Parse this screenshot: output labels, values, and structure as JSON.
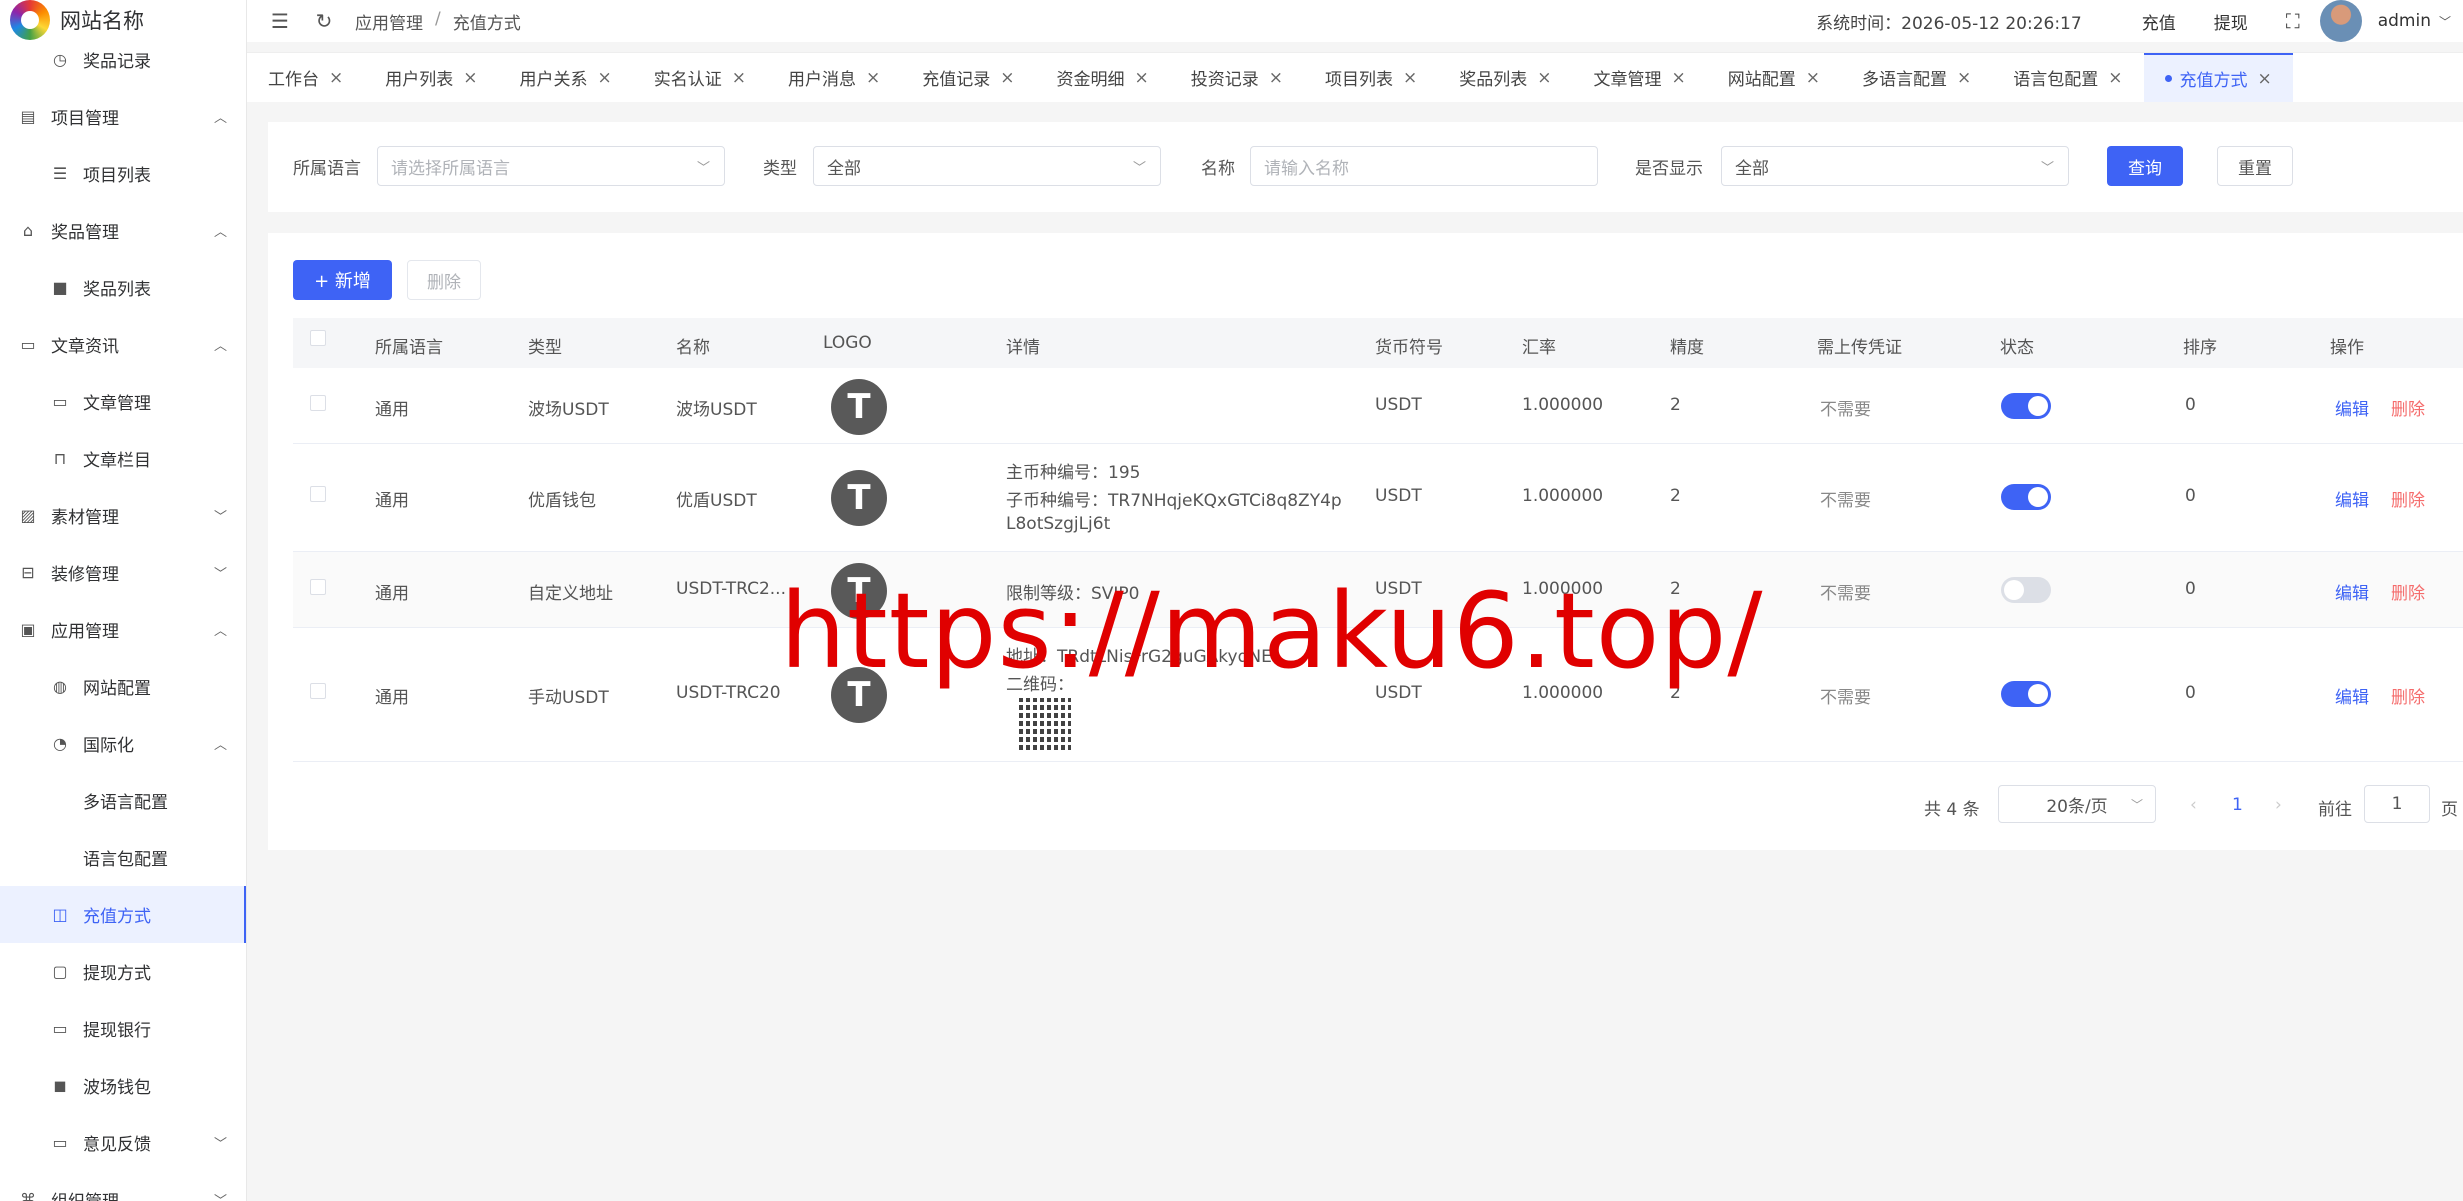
{
  "site": {
    "name": "网站名称"
  },
  "sidebar": {
    "items": [
      {
        "label": "奖品记录",
        "icon": "clock-icon"
      },
      {
        "label": "项目管理",
        "icon": "clipboard-icon",
        "expanded": true
      },
      {
        "label": "项目列表",
        "icon": "list-icon"
      },
      {
        "label": "奖品管理",
        "icon": "bag-icon",
        "expanded": true
      },
      {
        "label": "奖品列表",
        "icon": "bag-filled-icon"
      },
      {
        "label": "文章资讯",
        "icon": "message-icon",
        "expanded": true
      },
      {
        "label": "文章管理",
        "icon": "comment-icon"
      },
      {
        "label": "文章栏目",
        "icon": "bookmark-icon"
      },
      {
        "label": "素材管理",
        "icon": "picture-icon",
        "expanded": false
      },
      {
        "label": "装修管理",
        "icon": "brush-icon",
        "expanded": false
      },
      {
        "label": "应用管理",
        "icon": "app-icon",
        "expanded": true
      },
      {
        "label": "网站配置",
        "icon": "globe-icon"
      },
      {
        "label": "国际化",
        "icon": "compass-icon",
        "expanded": true
      },
      {
        "label": "多语言配置",
        "icon": ""
      },
      {
        "label": "语言包配置",
        "icon": ""
      },
      {
        "label": "充值方式",
        "icon": "wallet-icon",
        "active": true
      },
      {
        "label": "提现方式",
        "icon": "folder-icon"
      },
      {
        "label": "提现银行",
        "icon": "card-icon"
      },
      {
        "label": "波场钱包",
        "icon": "wallet-filled-icon"
      },
      {
        "label": "意见反馈",
        "icon": "feedback-icon",
        "expanded": false
      },
      {
        "label": "组织管理",
        "icon": "org-icon",
        "expanded": false
      }
    ]
  },
  "header": {
    "breadcrumb": [
      "应用管理",
      "充值方式"
    ],
    "breadcrumb_sep": "/",
    "system_time": "系统时间：2026-05-12 20:26:17",
    "recharge": "充值",
    "withdraw": "提现",
    "user": "admin"
  },
  "tabs": [
    "工作台",
    "用户列表",
    "用户关系",
    "实名认证",
    "用户消息",
    "充值记录",
    "资金明细",
    "投资记录",
    "项目列表",
    "奖品列表",
    "文章管理",
    "网站配置",
    "多语言配置",
    "语言包配置",
    "充值方式"
  ],
  "active_tab": "充值方式",
  "filter": {
    "lang_label": "所属语言",
    "lang_placeholder": "请选择所属语言",
    "type_label": "类型",
    "type_value": "全部",
    "name_label": "名称",
    "name_placeholder": "请输入名称",
    "show_label": "是否显示",
    "show_value": "全部",
    "query": "查询",
    "reset": "重置"
  },
  "toolbar": {
    "add": "+ 新增",
    "delete": "删除"
  },
  "table": {
    "columns": [
      "所属语言",
      "类型",
      "名称",
      "LOGO",
      "详情",
      "货币符号",
      "汇率",
      "精度",
      "需上传凭证",
      "状态",
      "排序",
      "操作"
    ],
    "edit": "编辑",
    "del": "删除",
    "rows": [
      {
        "lang": "通用",
        "type": "波场USDT",
        "name": "波场USDT",
        "details": [],
        "symbol": "USDT",
        "rate": "1.000000",
        "precision": "2",
        "proof": "不需要",
        "status": true,
        "sort": "0"
      },
      {
        "lang": "通用",
        "type": "优盾钱包",
        "name": "优盾USDT",
        "details": [
          "主币种编号：195",
          "子币种编号：TR7NHqjeKQxGTCi8q8ZY4p",
          "L8otSzgjLj6t"
        ],
        "symbol": "USDT",
        "rate": "1.000000",
        "precision": "2",
        "proof": "不需要",
        "status": true,
        "sort": "0"
      },
      {
        "lang": "通用",
        "type": "自定义地址",
        "name": "USDT-TRC2...",
        "details": [
          "限制等级：SVIP0"
        ],
        "symbol": "USDT",
        "rate": "1.000000",
        "precision": "2",
        "proof": "不需要",
        "status": false,
        "sort": "0"
      },
      {
        "lang": "通用",
        "type": "手动USDT",
        "name": "USDT-TRC20",
        "details": [
          "地址：TRdtLNisFrG2guGAkyqNE",
          "二维码："
        ],
        "symbol": "USDT",
        "rate": "1.000000",
        "precision": "2",
        "proof": "不需要",
        "status": true,
        "sort": "0"
      }
    ]
  },
  "pagination": {
    "total": "共 4 条",
    "page_size": "20条/页",
    "current": "1",
    "goto_label": "前往",
    "goto_value": "1",
    "page_suffix": "页"
  },
  "watermark": "https://maku6.top/",
  "colors": {
    "primary": "#3e63f5",
    "danger": "#f56c6c",
    "watermark": "#e00000"
  }
}
